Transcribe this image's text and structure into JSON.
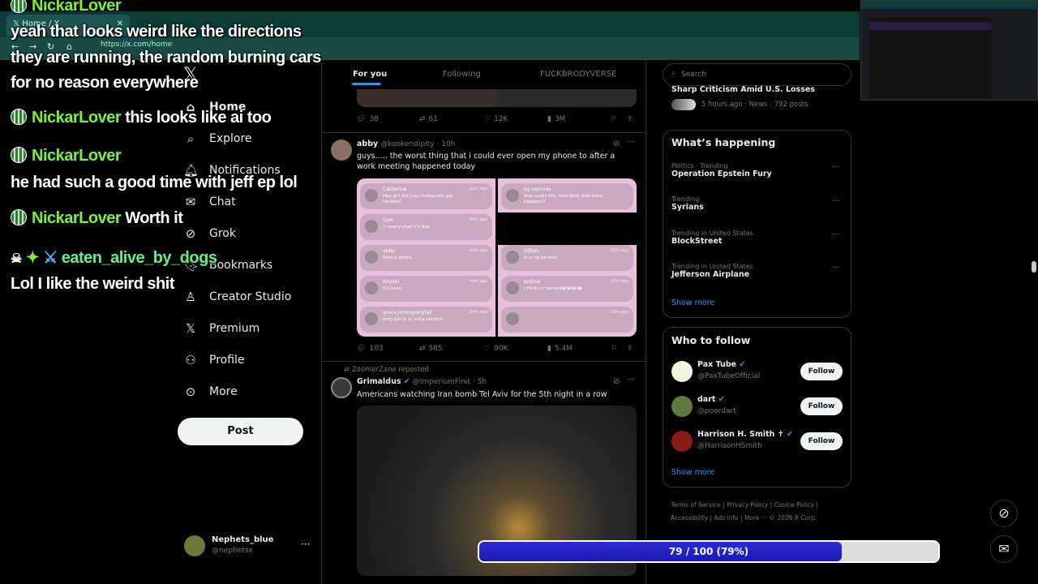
{
  "browser": {
    "tab_title": "Home / X",
    "url": "https://x.com/home"
  },
  "chat": [
    {
      "user": "NickarLover",
      "text": ""
    },
    {
      "user": "",
      "text": "yeah that looks weird like the directions"
    },
    {
      "user": "",
      "text": "they are running, the random burning cars"
    },
    {
      "user": "",
      "text": "for no reason everywhere"
    },
    {
      "user": "NickarLover",
      "text": "this looks like ai too"
    },
    {
      "user": "NickarLover",
      "text": ""
    },
    {
      "user": "",
      "text": "he had such a good time with jeff ep lol"
    },
    {
      "user": "NickarLover",
      "text": "Worth it"
    },
    {
      "user": "eaten_alive_by_dogs",
      "text": ""
    },
    {
      "user": "",
      "text": "Lol I like the weird shit"
    }
  ],
  "nav": {
    "items": [
      {
        "label": "Home",
        "icon": "home-icon"
      },
      {
        "label": "Explore",
        "icon": "search-icon"
      },
      {
        "label": "Notifications",
        "icon": "bell-icon"
      },
      {
        "label": "Chat",
        "icon": "mail-icon"
      },
      {
        "label": "Grok",
        "icon": "grok-icon"
      },
      {
        "label": "Bookmarks",
        "icon": "bookmark-icon"
      },
      {
        "label": "Creator Studio",
        "icon": "creator-icon"
      },
      {
        "label": "Premium",
        "icon": "x-logo-icon"
      },
      {
        "label": "Profile",
        "icon": "person-icon"
      },
      {
        "label": "More",
        "icon": "more-circle-icon"
      }
    ],
    "post_label": "Post",
    "account": {
      "name": "Nephets_blue",
      "handle": "@nephetsx"
    }
  },
  "timeline": {
    "tabs": [
      "For you",
      "Following",
      "FUCKBRODYVERSE"
    ],
    "active_tab": "For you",
    "posts": [
      {
        "actions": {
          "replies": "38",
          "reposts": "61",
          "likes": "12K",
          "views": "3M"
        }
      },
      {
        "name": "abby",
        "handle": "@kookendipity",
        "time": "10h",
        "text": "guys..... the worst thing that i could ever open my phone to after a work meeting happened today",
        "image_left": [
          {
            "name": "Catherine",
            "msg": "Hey girl did your instagram get hacked?",
            "time": "42m ago"
          },
          {
            "name": "Sam",
            "msg": "in every chat it's this",
            "time": "44m ago"
          },
          {
            "name": "abby",
            "msg": "Sent a photo.",
            "time": "44m ago"
          },
          {
            "name": "Khushi",
            "msg": "On insta",
            "time": "44m ago"
          },
          {
            "name": "grace jiminsponytail",
            "msg": "omg girl is ur insta hacked",
            "time": "44m ago"
          },
          {
            "name": "Graham",
            "msg": "",
            "time": "48m ago"
          }
        ],
        "image_right": [
          {
            "name": "og roomies",
            "msg": "that sucks tho, how does that even happen??",
            "time": ""
          },
          {
            "name": "",
            "msg": "ur ig got hacked",
            "time": ""
          },
          {
            "name": "Gillian",
            "msg": "is ur ig hacked",
            "time": "22m ago"
          },
          {
            "name": "Justine",
            "msg": "I think ur hacked😂😂😂😂",
            "time": "27m ago"
          },
          {
            "name": "",
            "msg": "",
            "time": "29m ago"
          }
        ],
        "actions": {
          "replies": "103",
          "reposts": "585",
          "likes": "90K",
          "views": "5.4M"
        }
      },
      {
        "repost_by": "ZoomerZane reposted",
        "name": "Grimaldus",
        "handle": "@ImperiumFirst",
        "time": "5h",
        "text": "Americans watching Iran bomb Tel Aviv for the 5th night in a row"
      }
    ]
  },
  "search": {
    "placeholder": "Search"
  },
  "news_snippet": {
    "title": "Sharp Criticism Amid U.S. Losses",
    "meta": "5 hours ago · News · 792 posts"
  },
  "happening": {
    "title": "What’s happening",
    "trends": [
      {
        "category": "Politics · Trending",
        "name": "Operation Epstein Fury"
      },
      {
        "category": "Trending",
        "name": "Syrians"
      },
      {
        "category": "Trending in United States",
        "name": "BlockStreet"
      },
      {
        "category": "Trending in United States",
        "name": "Jefferson Airplane"
      }
    ],
    "show_more": "Show more"
  },
  "who_to_follow": {
    "title": "Who to follow",
    "accounts": [
      {
        "name": "Pax Tube",
        "handle": "@PaxTubeOfficial",
        "button": "Follow"
      },
      {
        "name": "dart",
        "handle": "@poordart",
        "button": "Follow"
      },
      {
        "name": "Harrison H. Smith ✝",
        "handle": "@HarrisonHSmith",
        "button": "Follow"
      }
    ],
    "show_more": "Show more"
  },
  "footer": {
    "links": [
      "Terms of Service",
      "Privacy Policy",
      "Cookie Policy",
      "Accessibility",
      "Ads info",
      "More ···",
      "© 2026 X Corp."
    ]
  },
  "progress": {
    "label": "79 / 100 (79%)",
    "value": 0.79
  },
  "colors": {
    "accent": "#1d9bf0",
    "progress": "#2222c8",
    "chat_name": "#7cf03a"
  }
}
